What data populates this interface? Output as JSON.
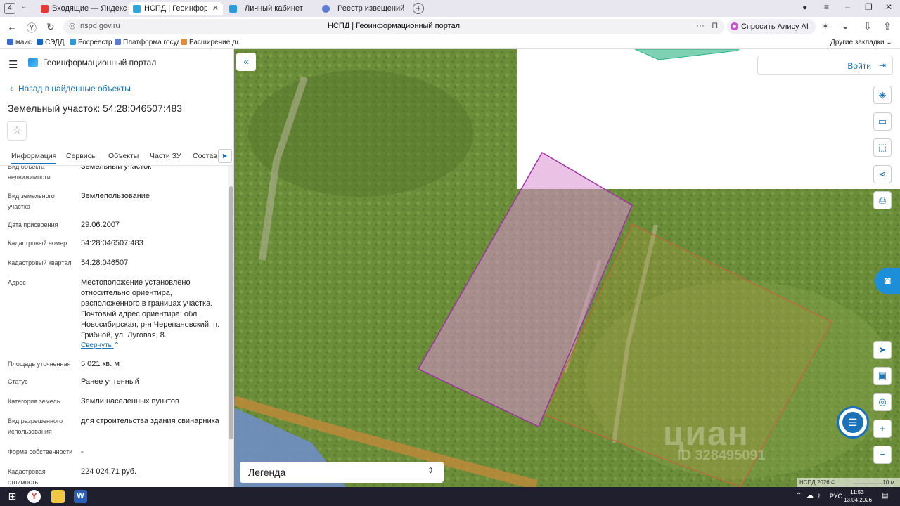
{
  "browser": {
    "tab_count": "4",
    "tabs": [
      {
        "title": "Входящие — Яндекс Почта",
        "active": false
      },
      {
        "title": "НСПД | Геоинформационный портал",
        "active": true
      },
      {
        "title": "Личный кабинет",
        "active": false
      },
      {
        "title": "Реестр извещений",
        "active": false
      }
    ],
    "url_domain": "nspd.gov.ru",
    "page_title": "НСПД | Геоинформационный портал",
    "alice_label": "Спросить Алису AI",
    "bookmarks": [
      "маис",
      "СЭДД",
      "Росреестр",
      "Платформа госуд...",
      "Расширение для..."
    ],
    "other_bookmarks": "Другие закладки"
  },
  "panel": {
    "portal_name": "Геоинформационный портал",
    "back_label": "Назад в найденные объекты",
    "title": "Земельный участок: 54:28:046507:483",
    "tabs": [
      "Информация",
      "Сервисы",
      "Объекты",
      "Части ЗУ",
      "Состав"
    ],
    "properties": [
      {
        "label": "Вид объекта недвижимости",
        "value": "Земельный участок"
      },
      {
        "label": "Вид земельного участка",
        "value": "Землепользование"
      },
      {
        "label": "Дата присвоения",
        "value": "29.06.2007"
      },
      {
        "label": "Кадастровый номер",
        "value": "54:28:046507:483"
      },
      {
        "label": "Кадастровый квартал",
        "value": "54:28:046507"
      },
      {
        "label": "Адрес",
        "value": "Местоположение установлено относительно ориентира, расположенного в границах участка. Почтовый адрес ориентира: обл. Новосибирская, р-н Черепановский, п. Грибной, ул. Луговая, 8."
      },
      {
        "label": "Площадь уточненная",
        "value": "5 021 кв. м"
      },
      {
        "label": "Статус",
        "value": "Ранее учтенный"
      },
      {
        "label": "Категория земель",
        "value": "Земли населенных пунктов"
      },
      {
        "label": "Вид разрешенного использования",
        "value": "для строительства здания свинарника"
      },
      {
        "label": "Форма собственности",
        "value": "-"
      },
      {
        "label": "Кадастровая стоимость",
        "value": "224 024,71 руб."
      }
    ],
    "collapse_label": "Свернуть"
  },
  "map": {
    "login_label": "Войти",
    "legend_label": "Легенда",
    "watermark": "циан",
    "watermark_id": "ID 328495091",
    "attribution": "НСПД 2026 ©",
    "scale": "10 м",
    "colors": {
      "parcel_fill": "#d98fd0",
      "parcel_stroke": "#a030a8",
      "neighbor_stroke": "#c8623a",
      "road": "#c88a3a",
      "accent": "#1a73b8"
    }
  },
  "taskbar": {
    "time": "11:53",
    "date": "13.04.2026",
    "lang": "РУС"
  }
}
